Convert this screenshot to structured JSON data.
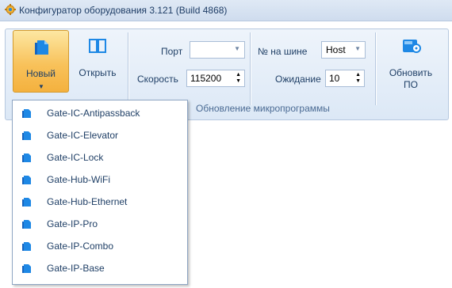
{
  "window": {
    "title": "Конфигуратор оборудования 3.121 (Build 4868)",
    "icon": "gear-icon"
  },
  "ribbon": {
    "new_button": {
      "label": "Новый",
      "icon": "new-document-icon",
      "state": "pressed"
    },
    "open_button": {
      "label": "Открыть",
      "icon": "open-book-icon"
    },
    "port": {
      "label": "Порт",
      "value": ""
    },
    "speed": {
      "label": "Скорость",
      "value": "115200"
    },
    "bus_number": {
      "label": "№ на шине",
      "value": "Host"
    },
    "timeout": {
      "label": "Ожидание",
      "value": "10"
    },
    "update_button": {
      "label": "Обновить ПО",
      "line1": "Обновить",
      "line2": "ПО",
      "icon": "firmware-disk-icon"
    },
    "group_caption": "Обновление микропрограммы"
  },
  "dropdown_menu": {
    "items": [
      {
        "label": "Gate-IC-Antipassback"
      },
      {
        "label": "Gate-IC-Elevator"
      },
      {
        "label": "Gate-IC-Lock"
      },
      {
        "label": "Gate-Hub-WiFi"
      },
      {
        "label": "Gate-Hub-Ethernet"
      },
      {
        "label": "Gate-IP-Pro"
      },
      {
        "label": "Gate-IP-Combo"
      },
      {
        "label": "Gate-IP-Base"
      }
    ]
  },
  "colors": {
    "accent_orange": "#f8c25b",
    "ribbon_bg": "#dce8f6",
    "text_blue": "#1f3f66",
    "item_icon_blue": "#1e88e5"
  }
}
